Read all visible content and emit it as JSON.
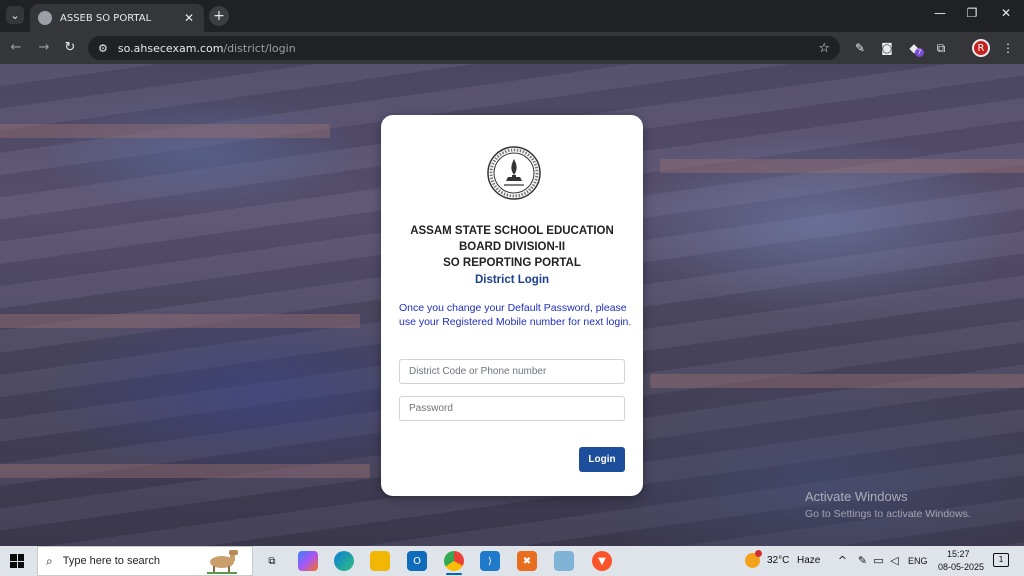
{
  "browser": {
    "tab_title": "ASSEB SO PORTAL",
    "url_host": "so.ahsecexam.com",
    "url_path": "/district/login",
    "extension_badge_count": "7",
    "profile_initial": "R"
  },
  "login": {
    "heading_line1": "ASSAM STATE SCHOOL EDUCATION",
    "heading_line2": "BOARD DIVISION-II",
    "heading_line3": "SO REPORTING PORTAL",
    "subheading": "District Login",
    "notice": "Once you change your Default Password, please use your Registered Mobile number for next login.",
    "username_placeholder": "District Code or Phone number",
    "password_placeholder": "Password",
    "login_label": "Login"
  },
  "watermark": {
    "title": "Activate Windows",
    "subtitle": "Go to Settings to activate Windows."
  },
  "taskbar": {
    "search_placeholder": "Type here to search",
    "weather_temp": "32°C",
    "weather_desc": "Haze",
    "language": "ENG",
    "time": "15:27",
    "date": "08-05-2025",
    "notification_count": "1"
  },
  "colors": {
    "primary_button": "#1c4e9b",
    "notice_text": "#1f2fbf",
    "subheading": "#1a3f8b"
  }
}
